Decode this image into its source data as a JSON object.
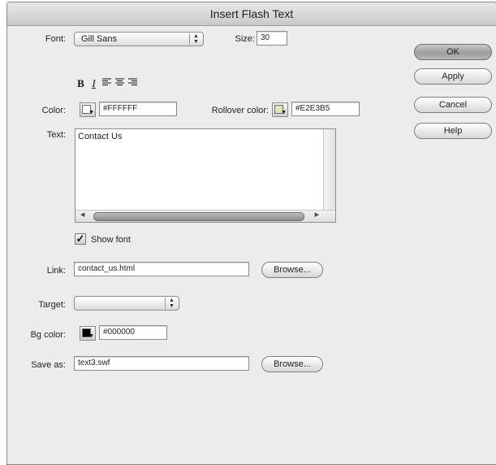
{
  "window": {
    "title": "Insert Flash Text"
  },
  "font": {
    "label": "Font:",
    "value": "Gill Sans"
  },
  "size": {
    "label": "Size:",
    "value": "30"
  },
  "format_buttons": {
    "bold": "B",
    "italic": "I"
  },
  "color": {
    "label": "Color:",
    "value": "#FFFFFF"
  },
  "rollover_color": {
    "label": "Rollover color:",
    "value": "#E2E3B5"
  },
  "text": {
    "label": "Text:",
    "value": "Contact Us"
  },
  "show_font": {
    "label": "Show font",
    "checked": true
  },
  "link": {
    "label": "Link:",
    "value": "contact_us.html"
  },
  "target": {
    "label": "Target:",
    "value": ""
  },
  "bg_color": {
    "label": "Bg color:",
    "value": "#000000"
  },
  "save_as": {
    "label": "Save as:",
    "value": "text3.swf"
  },
  "browse_label": "Browse...",
  "buttons": {
    "ok": "OK",
    "apply": "Apply",
    "cancel": "Cancel",
    "help": "Help"
  },
  "colors": {
    "chrome": "#ececec",
    "rollover_swatch": "#E2E3B5",
    "bg_swatch": "#000000",
    "color_swatch": "#FFFFFF"
  },
  "icons": [
    "popup-arrows-icon",
    "bold-icon",
    "italic-icon",
    "align-left-icon",
    "align-center-icon",
    "align-right-icon",
    "color-picker-icon",
    "checkmark-icon"
  ]
}
